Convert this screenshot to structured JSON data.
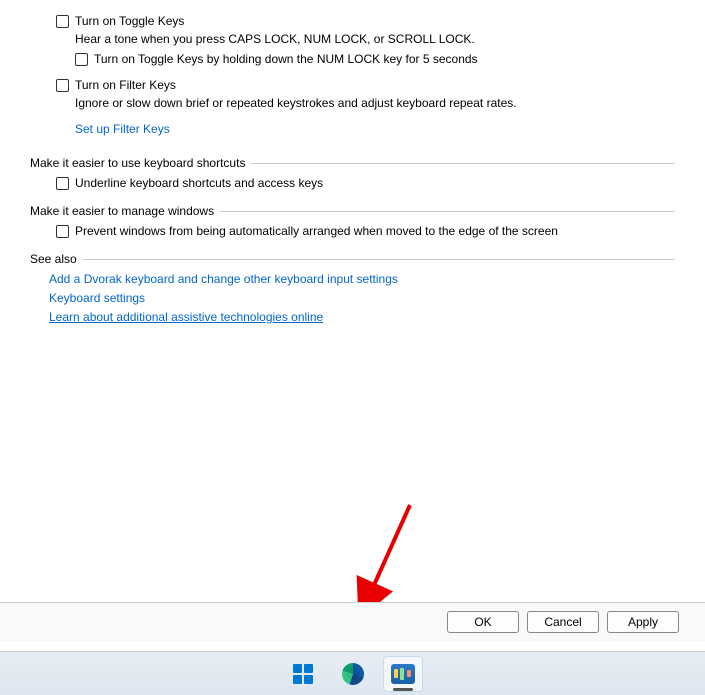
{
  "toggleKeys": {
    "checkboxLabel": "Turn on Toggle Keys",
    "description": "Hear a tone when you press CAPS LOCK, NUM LOCK, or SCROLL LOCK.",
    "subCheckboxLabel": "Turn on Toggle Keys by holding down the NUM LOCK key for 5 seconds"
  },
  "filterKeys": {
    "checkboxLabel": "Turn on Filter Keys",
    "description": "Ignore or slow down brief or repeated keystrokes and adjust keyboard repeat rates.",
    "setupLink": "Set up Filter Keys"
  },
  "shortcuts": {
    "header": "Make it easier to use keyboard shortcuts",
    "checkboxLabel": "Underline keyboard shortcuts and access keys"
  },
  "manageWindows": {
    "header": "Make it easier to manage windows",
    "checkboxLabel": "Prevent windows from being automatically arranged when moved to the edge of the screen"
  },
  "seeAlso": {
    "header": "See also",
    "links": [
      "Add a Dvorak keyboard and change other keyboard input settings",
      "Keyboard settings",
      "Learn about additional assistive technologies online"
    ]
  },
  "buttons": {
    "ok": "OK",
    "cancel": "Cancel",
    "apply": "Apply"
  }
}
